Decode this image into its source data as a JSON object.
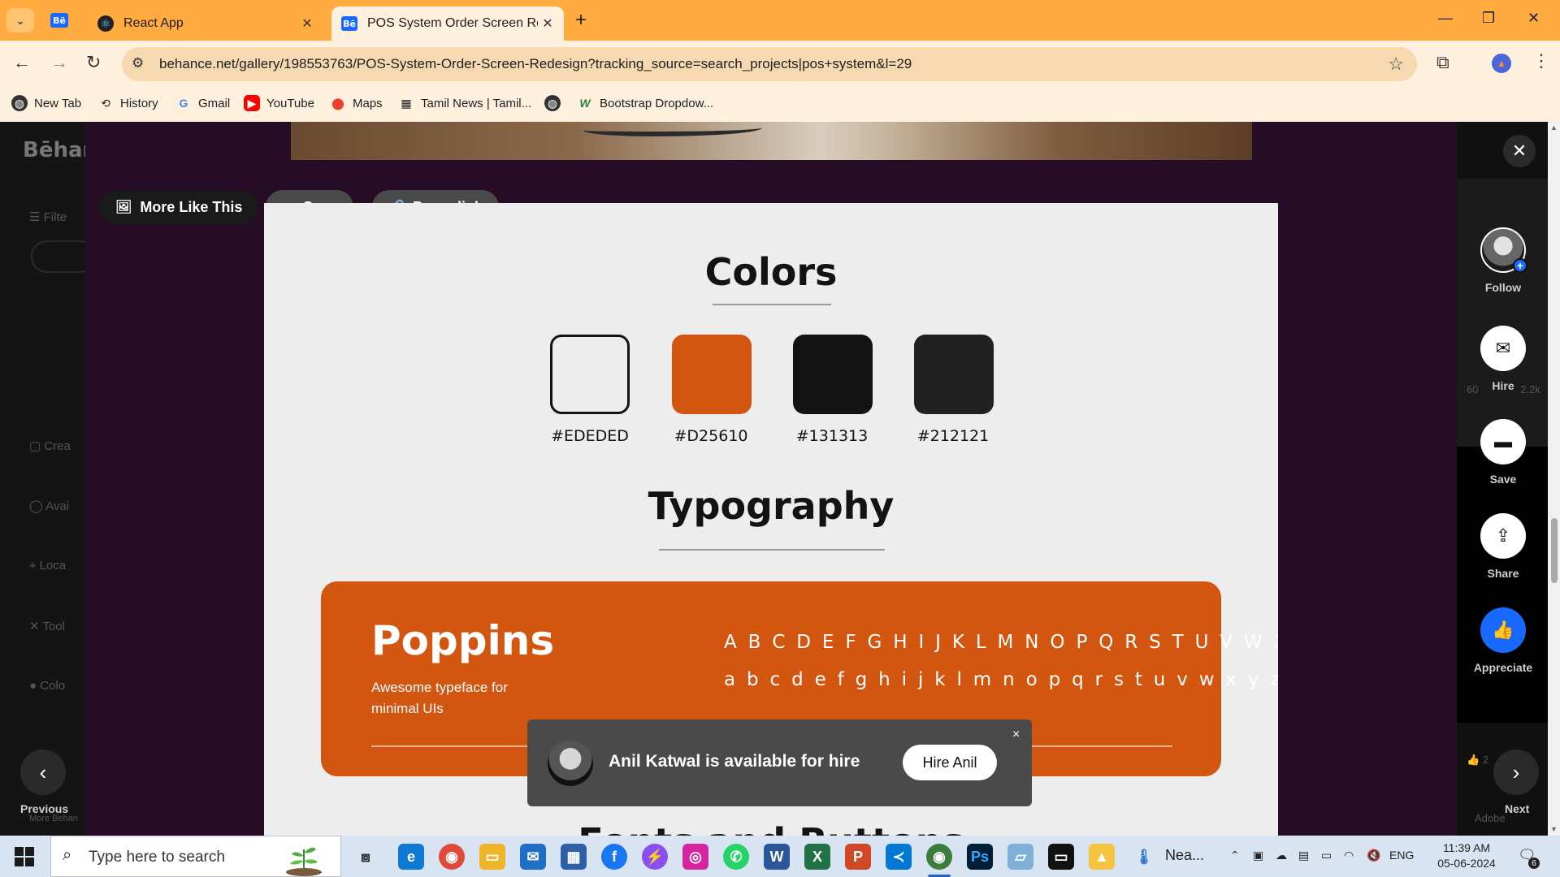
{
  "browser": {
    "tabs": [
      {
        "title": "React App",
        "active": false
      },
      {
        "title": "POS System Order Screen Rede",
        "active": true
      }
    ],
    "url": "behance.net/gallery/198553763/POS-System-Order-Screen-Redesign?tracking_source=search_projects|pos+system&l=29",
    "bookmarks": [
      "New Tab",
      "History",
      "Gmail",
      "YouTube",
      "Maps",
      "Tamil News | Tamil...",
      "",
      "Bootstrap Dropdow..."
    ]
  },
  "background_page": {
    "logo": "Bēhan",
    "filter_label": "Filte",
    "sidebar": [
      "Crea",
      "Avai",
      "Loca",
      "Tool",
      "Colo"
    ],
    "footer": "More Behan",
    "right_rail": {
      "brand": "Adobe",
      "stat1": "60",
      "stat2": "2.2k",
      "likes": "2"
    }
  },
  "actions": {
    "more_like_this": "More Like This",
    "save": "Save",
    "permalink": "Permalink"
  },
  "project": {
    "colors_title": "Colors",
    "swatches": [
      {
        "hex": "#EDEDED",
        "label": "#EDEDED"
      },
      {
        "hex": "#D25610",
        "label": "#D25610"
      },
      {
        "hex": "#131313",
        "label": "#131313"
      },
      {
        "hex": "#212121",
        "label": "#212121"
      }
    ],
    "typography_title": "Typography",
    "font": {
      "name": "Poppins",
      "description": "Awesome typeface for minimal UIs",
      "uppercase": "A B C D E F G H I J K L M N O P Q R S T U V W X Y Z",
      "lowercase": "a b c d e f g h i j k l m n o p q r s t u v w x y z"
    },
    "next_section_peek": "Fonts and Buttons"
  },
  "hire_toast": {
    "text": "Anil Katwal is available for hire",
    "button": "Hire Anil",
    "close": "×"
  },
  "side_rail": {
    "follow": "Follow",
    "hire": "Hire",
    "save": "Save",
    "share": "Share",
    "appreciate": "Appreciate"
  },
  "navigation": {
    "previous": "Previous",
    "next": "Next"
  },
  "taskbar": {
    "search_placeholder": "Type here to search",
    "weather": "Nea...",
    "language": "ENG",
    "time": "11:39 AM",
    "date": "05-06-2024",
    "notifications": "6"
  },
  "colors": {
    "accent_orange": "#D25610",
    "behance_blue": "#1769FF",
    "chrome_orange": "#FFAB40"
  }
}
